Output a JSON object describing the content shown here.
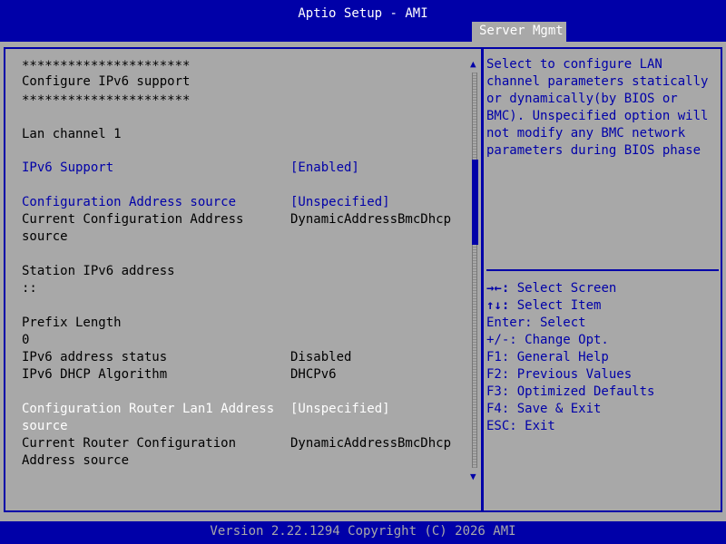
{
  "header": {
    "title": "Aptio Setup - AMI",
    "active_tab": "Server Mgmt"
  },
  "main": {
    "banner_top": "**********************",
    "banner_title": "Configure IPv6 support",
    "banner_bottom": "**********************",
    "channel_label": "Lan channel 1",
    "ipv6_support": {
      "label": "IPv6 Support",
      "value": "[Enabled]"
    },
    "config_address_source": {
      "label": "Configuration Address source",
      "value": "[Unspecified]"
    },
    "current_config_address": {
      "label_line1": "Current Configuration Address",
      "label_line2": "source",
      "value": "DynamicAddressBmcDhcp"
    },
    "station_ipv6": {
      "label": "Station IPv6 address",
      "value": "::"
    },
    "prefix_length": {
      "label": "Prefix Length",
      "value": "0"
    },
    "ipv6_address_status": {
      "label": "IPv6 address status",
      "value": "Disabled"
    },
    "ipv6_dhcp_algorithm": {
      "label": "IPv6 DHCP Algorithm",
      "value": "DHCPv6"
    },
    "config_router_lan1": {
      "label_line1": "Configuration Router Lan1 Address",
      "label_line2": "source",
      "value": "[Unspecified]"
    },
    "current_router_config": {
      "label_line1": "Current Router Configuration",
      "label_line2": "Address source",
      "value": "DynamicAddressBmcDhcp"
    }
  },
  "help": {
    "lines": [
      "Select to configure LAN",
      "channel parameters statically",
      "or dynamically(by BIOS or",
      "BMC). Unspecified option will",
      "not modify any BMC network",
      "parameters during BIOS phase"
    ]
  },
  "keys": {
    "select_screen": {
      "key": "→←:",
      "action": " Select Screen"
    },
    "select_item": {
      "key": "↑↓:",
      "action": " Select Item"
    },
    "lines": [
      "Enter: Select",
      "+/-: Change Opt.",
      "F1: General Help",
      "F2: Previous Values",
      "F3: Optimized Defaults",
      "F4: Save & Exit",
      "ESC: Exit"
    ]
  },
  "scrollbar": {
    "up_icon": "arrow-up-icon",
    "down_icon": "arrow-down-icon",
    "position_fraction": 0.22
  },
  "footer": {
    "version": "Version 2.22.1294 Copyright (C) 2026 AMI"
  },
  "colors": {
    "background": "#a8a8a8",
    "bar_blue": "#0000a8",
    "highlight_white": "#ffffff"
  }
}
